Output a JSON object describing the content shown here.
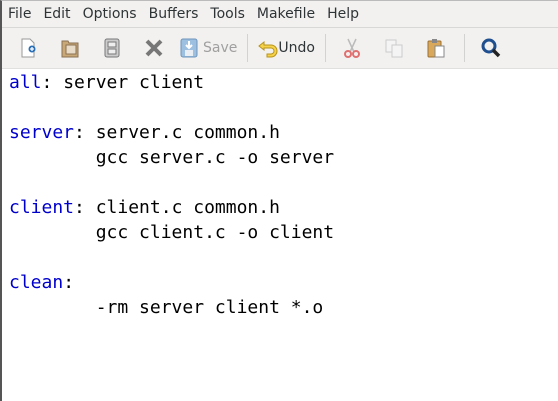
{
  "menu": [
    "File",
    "Edit",
    "Options",
    "Buffers",
    "Tools",
    "Makefile",
    "Help"
  ],
  "toolbar": {
    "new": {
      "icon": "new-file-icon"
    },
    "open": {
      "icon": "open-folder-icon"
    },
    "dired": {
      "icon": "file-cabinet-icon"
    },
    "close": {
      "icon": "close-x-icon"
    },
    "save": {
      "icon": "save-icon",
      "label": "Save"
    },
    "undo": {
      "icon": "undo-arrow-icon",
      "label": "Undo"
    },
    "cut": {
      "icon": "scissors-icon"
    },
    "copy": {
      "icon": "copy-icon"
    },
    "paste": {
      "icon": "paste-clipboard-icon"
    },
    "search": {
      "icon": "magnifier-icon"
    }
  },
  "colors": {
    "target": "#0000cc",
    "text": "#000000",
    "chrome": "#f2f1f0"
  },
  "buffer": {
    "lines": [
      {
        "target": "all",
        "rest": ": server client"
      },
      {
        "target": "",
        "rest": ""
      },
      {
        "target": "server",
        "rest": ": server.c common.h"
      },
      {
        "target": "",
        "rest": "        gcc server.c -o server"
      },
      {
        "target": "",
        "rest": ""
      },
      {
        "target": "client",
        "rest": ": client.c common.h"
      },
      {
        "target": "",
        "rest": "        gcc client.c -o client"
      },
      {
        "target": "",
        "rest": ""
      },
      {
        "target": "clean",
        "rest": ":"
      },
      {
        "target": "",
        "rest": "        -rm server client *.o"
      }
    ]
  }
}
